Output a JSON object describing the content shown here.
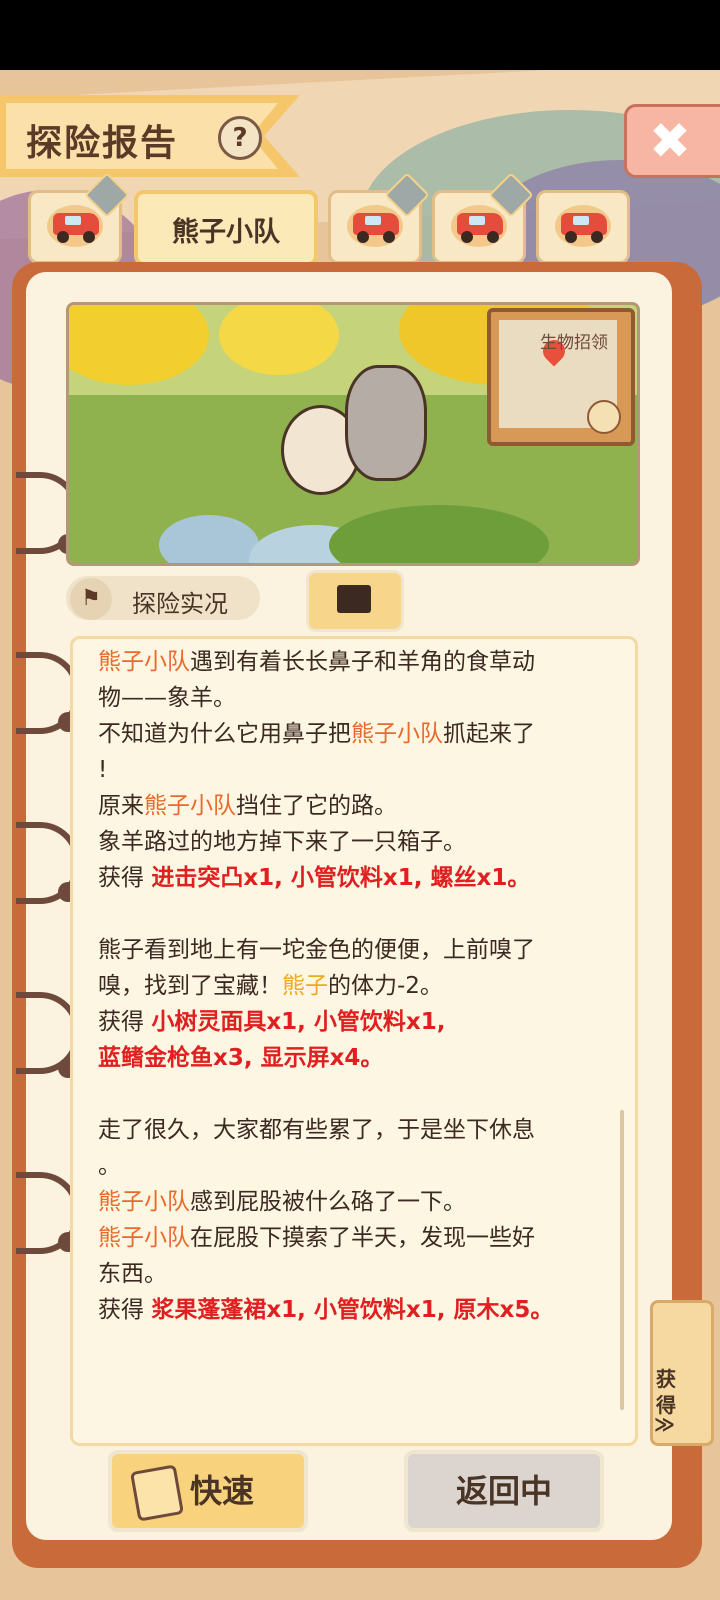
{
  "header": {
    "title": "探险报告",
    "help_icon": "?"
  },
  "tabs": [
    {
      "type": "car",
      "has_badge": true
    },
    {
      "label": "熊子小队",
      "active": true
    },
    {
      "type": "car",
      "has_badge": true
    },
    {
      "type": "car",
      "has_badge": true
    },
    {
      "type": "car",
      "has_badge": false
    }
  ],
  "scene": {
    "map_label": "生物招领"
  },
  "section": {
    "label": "探险实况"
  },
  "log": {
    "l1": "熊子小队",
    "l1b": "遇到有着长长鼻子和羊角的食草动",
    "l2": "物——象羊。",
    "l3a": "不知道为什么它用鼻子把",
    "l3b": "熊子小队",
    "l3c": "抓起来了",
    "l4": "!",
    "l5a": "原来",
    "l5b": "熊子小队",
    "l5c": "挡住了它的路。",
    "l6": "象羊路过的地方掉下来了一只箱子。",
    "l7a": "获得 ",
    "l7b": "进击突凸x1, 小管饮料x1, 螺丝x1。",
    "l8": "熊子看到地上有一坨金色的便便，上前嗅了",
    "l9a": "嗅，找到了宝藏！",
    "l9b": "熊子",
    "l9c": "的体力-2。",
    "l10a": "获得 ",
    "l10b": "小树灵面具x1, 小管饮料x1,",
    "l11": "蓝鳍金枪鱼x3, 显示屏x4。",
    "l12": "走了很久，大家都有些累了，于是坐下休息",
    "l13": "。",
    "l14a": "熊子小队",
    "l14b": "感到屁股被什么硌了一下。",
    "l15a": "熊子小队",
    "l15b": "在屁股下摸索了半天，发现一些好",
    "l16": "东西。",
    "l17a": "获得 ",
    "l17b": "浆果蓬蓬裙x1, 小管饮料x1, 原木x5。"
  },
  "side_tag": {
    "label": "获得",
    "arrow": "≫"
  },
  "buttons": {
    "quick": "快速",
    "returning": "返回中"
  },
  "colors": {
    "highlight_team": "#e86a2c",
    "highlight_member": "#eeaa1e",
    "reward": "#e02020"
  }
}
